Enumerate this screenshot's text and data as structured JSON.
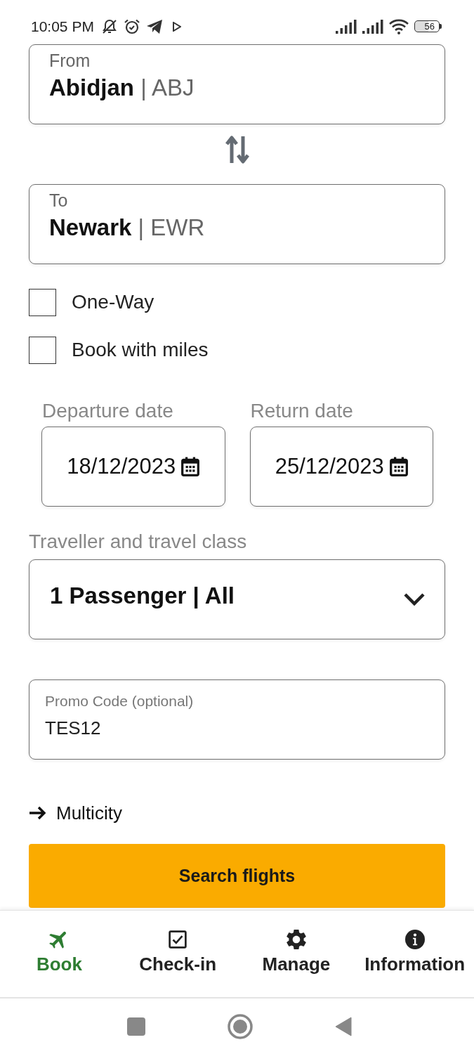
{
  "status_bar": {
    "time": "10:05 PM",
    "battery": "56"
  },
  "route": [
    {
      "label": "From",
      "value": "**Abidjan** | ABJ"
    },
    {
      "label": "To",
      "value": "**Newark** | EWR"
    }
  ],
  "options": [
    {
      "label": "One-Way",
      "checked": false
    },
    {
      "label": "Book with miles",
      "checked": false
    }
  ],
  "dates": [
    {
      "label": "Departure date",
      "value": "18/12/2023"
    },
    {
      "label": "Return date",
      "value": "25/12/2023"
    }
  ],
  "traveller": {
    "label": "Traveller and travel class",
    "value": "1 Passenger | All"
  },
  "promo": {
    "label": "Promo Code (optional)",
    "value": "TES12"
  },
  "multicity": {
    "label": "Multicity"
  },
  "search_button": {
    "label": "Search flights"
  },
  "bottom_nav": [
    {
      "label": "Book",
      "selected": true
    },
    {
      "label": "Check-in",
      "selected": false
    },
    {
      "label": "Manage",
      "selected": false
    },
    {
      "label": "Information",
      "selected": false
    }
  ]
}
